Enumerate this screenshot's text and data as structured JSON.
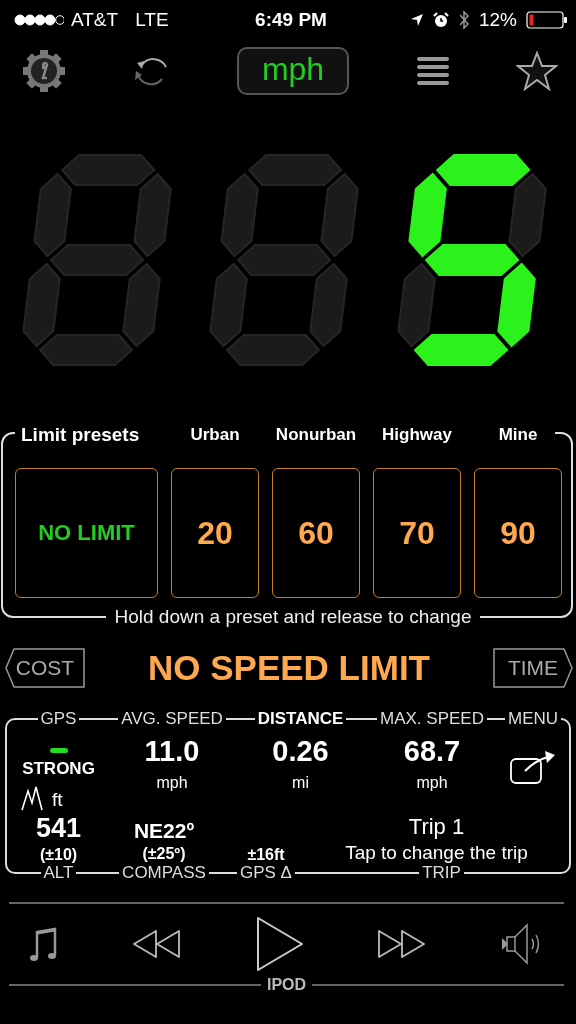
{
  "status_bar": {
    "carrier": "AT&T",
    "network": "LTE",
    "time": "6:49 PM",
    "battery": "12%"
  },
  "toolbar": {
    "unit": "mph"
  },
  "speed_display": {
    "digits": [
      {
        "segments": [
          {
            "lit": false
          },
          {
            "lit": false
          },
          {
            "lit": false
          },
          {
            "lit": false
          },
          {
            "lit": false
          },
          {
            "lit": false
          },
          {
            "lit": false
          }
        ]
      },
      {
        "segments": [
          {
            "lit": false
          },
          {
            "lit": false
          },
          {
            "lit": false
          },
          {
            "lit": false
          },
          {
            "lit": false
          },
          {
            "lit": false
          },
          {
            "lit": false
          }
        ]
      },
      {
        "segments": [
          {
            "lit": true
          },
          {
            "lit": false
          },
          {
            "lit": true
          },
          {
            "lit": true
          },
          {
            "lit": false
          },
          {
            "lit": true
          },
          {
            "lit": true
          }
        ]
      }
    ]
  },
  "limit_presets": {
    "title": "Limit presets",
    "hint": "Hold down a preset and release to change",
    "presets": [
      {
        "value": "NO LIMIT",
        "selected": true
      },
      {
        "heading": "Urban",
        "value": "20",
        "selected": false
      },
      {
        "heading": "Nonurban",
        "value": "60",
        "selected": false
      },
      {
        "heading": "Highway",
        "value": "70",
        "selected": false
      },
      {
        "heading": "Mine",
        "value": "90",
        "selected": false
      }
    ]
  },
  "limit_row": {
    "left_button": "COST",
    "status": "NO SPEED LIMIT",
    "right_button": "TIME"
  },
  "stats": {
    "top_labels": [
      "GPS",
      "AVG. SPEED",
      "DISTANCE",
      "MAX. SPEED",
      "MENU"
    ],
    "gps_strength": "STRONG",
    "values": [
      {
        "value": "11.0",
        "unit": "mph"
      },
      {
        "value": "0.26",
        "unit": "mi"
      },
      {
        "value": "68.7",
        "unit": "mph"
      }
    ],
    "alt_unit": "ft",
    "altitude": "541",
    "altitude_error": "(±10)",
    "compass": "NE22º",
    "compass_error": "(±25º)",
    "gps_error": "±16ft",
    "trip": "Trip 1",
    "trip_hint": "Tap to change the trip",
    "bottom_labels": [
      "ALT",
      "COMPASS",
      "GPS Δ",
      "TRIP"
    ]
  },
  "ipod": {
    "label": "IPOD"
  }
}
